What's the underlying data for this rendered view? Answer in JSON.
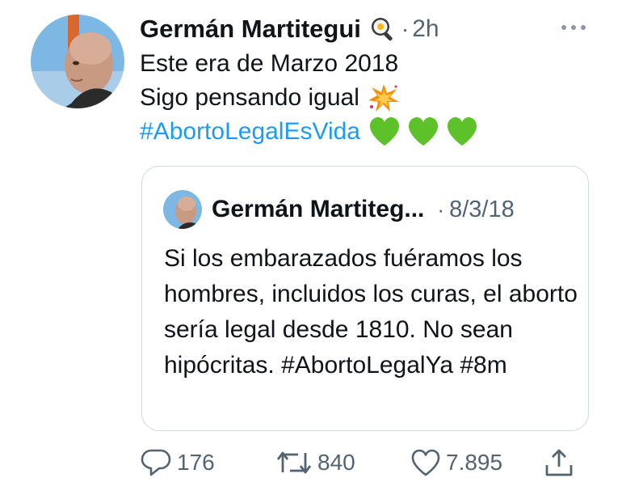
{
  "tweet": {
    "author_name": "Germán Martitegui",
    "author_emoji": "frying-pan-egg-icon",
    "separator": "·",
    "time": "2h",
    "text_lines": [
      "Este era de Marzo 2018",
      "Sigo pensando igual"
    ],
    "hashtag": "#AbortoLegalEsVida",
    "line2_emoji": "collision-icon",
    "trailing_emojis": [
      "green-heart-icon",
      "green-heart-icon",
      "green-heart-icon"
    ]
  },
  "quoted": {
    "author_name": "Germán Martiteg...",
    "separator": "·",
    "date": "8/3/18",
    "text": "Si los embarazados fuéramos los hombres, incluidos los curas, el aborto sería legal desde 1810. No sean hipócritas. #AbortoLegalYa #8m"
  },
  "actions": {
    "replies": "176",
    "retweets": "840",
    "likes": "7.895"
  },
  "colors": {
    "link": "#1d9bf0",
    "secondary_text": "#536471",
    "border": "#cfd9de",
    "green_heart": "#5dc229"
  }
}
